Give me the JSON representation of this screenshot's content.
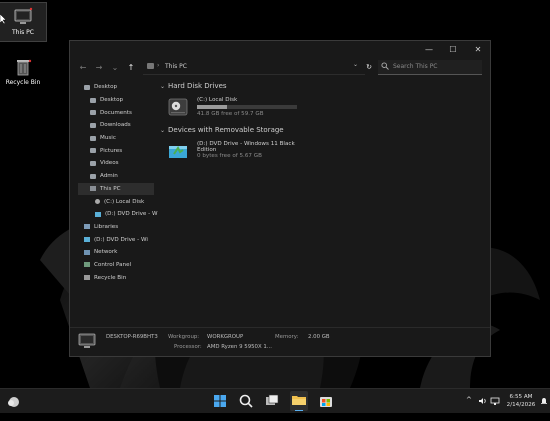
{
  "desktop": {
    "icons": [
      {
        "label": "This PC"
      },
      {
        "label": "Recycle Bin"
      }
    ]
  },
  "window": {
    "minimize_glyph": "—",
    "maximize_glyph": "☐",
    "close_glyph": "✕",
    "address": {
      "location": "This PC",
      "separator": "›"
    },
    "search_placeholder": "Search This PC",
    "nav": {
      "back": "←",
      "forward": "→",
      "recent": "⌄",
      "up": "↑",
      "chevron": "⌄",
      "refresh": "↻"
    }
  },
  "sidebar": {
    "items": [
      {
        "label": "Desktop",
        "icon": "desktop-folder-icon"
      },
      {
        "label": "Desktop",
        "icon": "folder-icon"
      },
      {
        "label": "Documents",
        "icon": "folder-icon"
      },
      {
        "label": "Downloads",
        "icon": "folder-icon"
      },
      {
        "label": "Music",
        "icon": "folder-icon"
      },
      {
        "label": "Pictures",
        "icon": "folder-icon"
      },
      {
        "label": "Videos",
        "icon": "folder-icon"
      },
      {
        "label": "Admin",
        "icon": "folder-icon"
      },
      {
        "label": "This PC",
        "icon": "computer-icon"
      },
      {
        "label": "(C:) Local Disk",
        "icon": "drive-icon"
      },
      {
        "label": "(D:) DVD Drive - W",
        "icon": "dvd-icon"
      },
      {
        "label": "Libraries",
        "icon": "library-icon"
      },
      {
        "label": "(D:) DVD Drive - Wi",
        "icon": "dvd-icon"
      },
      {
        "label": "Network",
        "icon": "network-icon"
      },
      {
        "label": "Control Panel",
        "icon": "control-panel-icon"
      },
      {
        "label": "Recycle Bin",
        "icon": "recycle-bin-icon"
      }
    ]
  },
  "content": {
    "hard_disk_header": "Hard Disk Drives",
    "removable_header": "Devices with Removable Storage",
    "local_disk": {
      "name": "(C:) Local Disk",
      "free": "41.8 GB free of 59.7 GB",
      "used_fraction": 0.3
    },
    "dvd_drive": {
      "name_line1": "(D:) DVD Drive - Windows 11 Black",
      "name_line2": "Edition",
      "free": "0 bytes free of 5.67 GB"
    }
  },
  "details": {
    "computer_name": "DESKTOP-R69BHT3",
    "workgroup_label": "Workgroup:",
    "workgroup_value": "WORKGROUP",
    "memory_label": "Memory:",
    "memory_value": "2.00 GB",
    "processor_label": "Processor:",
    "processor_value": "AMD Ryzen 9 5950X 1..."
  },
  "taskbar": {
    "time": "6:55 AM",
    "date": "2/14/2026",
    "tray_chevron": "^"
  }
}
